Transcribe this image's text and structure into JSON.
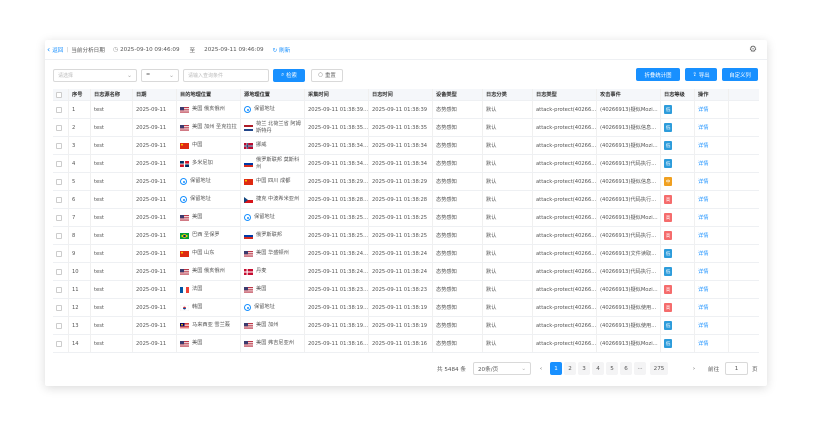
{
  "topbar": {
    "back_label": "返回",
    "divider": "|",
    "analysis_label": "当前分析日期",
    "start": "2025-09-10 09:46:09",
    "to": "至",
    "end": "2025-09-11 09:46:09",
    "refresh": "刷新"
  },
  "filters": {
    "type_placeholder": "请选择",
    "op_value": "=",
    "query_placeholder": "请输入查询条件",
    "search_label": "检索",
    "reset_label": "重置"
  },
  "actions": {
    "stats_label": "折叠统计图",
    "export_label": "导出",
    "custom_columns_label": "自定义列"
  },
  "columns": [
    "序号",
    "日志源名称",
    "日期",
    "目的地理位置",
    "源地理位置",
    "采集时间",
    "日志时间",
    "设备类型",
    "日志分类",
    "日志类型",
    "攻击事件",
    "日志等级",
    "操作"
  ],
  "rows": [
    {
      "no": "1",
      "src": "test",
      "date": "2025-09-11",
      "dest": "美国 俄亥俄州",
      "dest_flag": "us",
      "srcloc": "保留地址",
      "srcloc_flag": "pin",
      "collect": "2025-09-11 01:38:39...",
      "log": "2025-09-11 01:38:39",
      "device": "态势感知",
      "cls": "默认",
      "type": "attack-protect(40266...",
      "event": "(40266913)疑似Mozi...",
      "lvl": "低",
      "op": "详情"
    },
    {
      "no": "2",
      "src": "test",
      "date": "2025-09-11",
      "dest": "美国 加州 圣克拉拉",
      "dest_flag": "us",
      "srcloc": "荷兰 北荷兰省 阿姆斯特丹",
      "srcloc_flag": "nl",
      "collect": "2025-09-11 01:38:35...",
      "log": "2025-09-11 01:38:35",
      "device": "态势感知",
      "cls": "默认",
      "type": "attack-protect(40266...",
      "event": "(40266913)疑似信息...",
      "lvl": "低",
      "op": "详情"
    },
    {
      "no": "3",
      "src": "test",
      "date": "2025-09-11",
      "dest": "中国",
      "dest_flag": "cn",
      "srcloc": "挪威",
      "srcloc_flag": "no",
      "collect": "2025-09-11 01:38:34...",
      "log": "2025-09-11 01:38:34",
      "device": "态势感知",
      "cls": "默认",
      "type": "attack-protect(40266...",
      "event": "(40266913)疑似Mozi...",
      "lvl": "低",
      "op": "详情"
    },
    {
      "no": "4",
      "src": "test",
      "date": "2025-09-11",
      "dest": "多米尼加",
      "dest_flag": "do",
      "srcloc": "俄罗斯联邦 莫斯科州",
      "srcloc_flag": "ru",
      "collect": "2025-09-11 01:38:34...",
      "log": "2025-09-11 01:38:34",
      "device": "态势感知",
      "cls": "默认",
      "type": "attack-protect(40266...",
      "event": "(40266913)代码执行...",
      "lvl": "低",
      "op": "详情"
    },
    {
      "no": "5",
      "src": "test",
      "date": "2025-09-11",
      "dest": "保留地址",
      "dest_flag": "pin",
      "srcloc": "中国 四川 成都",
      "srcloc_flag": "cn",
      "collect": "2025-09-11 01:38:29...",
      "log": "2025-09-11 01:38:29",
      "device": "态势感知",
      "cls": "默认",
      "type": "attack-protect(40266...",
      "event": "(40266913)疑似信息...",
      "lvl": "中",
      "op": "详情"
    },
    {
      "no": "6",
      "src": "test",
      "date": "2025-09-11",
      "dest": "保留地址",
      "dest_flag": "pin",
      "srcloc": "捷克 中波希米亚州",
      "srcloc_flag": "cz",
      "collect": "2025-09-11 01:38:28...",
      "log": "2025-09-11 01:38:28",
      "device": "态势感知",
      "cls": "默认",
      "type": "attack-protect(40266...",
      "event": "(40266913)代码执行...",
      "lvl": "高",
      "op": "详情"
    },
    {
      "no": "7",
      "src": "test",
      "date": "2025-09-11",
      "dest": "美国",
      "dest_flag": "us",
      "srcloc": "保留地址",
      "srcloc_flag": "pin",
      "collect": "2025-09-11 01:38:25...",
      "log": "2025-09-11 01:38:25",
      "device": "态势感知",
      "cls": "默认",
      "type": "attack-protect(40266...",
      "event": "(40266913)疑似Mozi...",
      "lvl": "高",
      "op": "详情"
    },
    {
      "no": "8",
      "src": "test",
      "date": "2025-09-11",
      "dest": "巴西 圣保罗",
      "dest_flag": "br",
      "srcloc": "俄罗斯联邦",
      "srcloc_flag": "ru",
      "collect": "2025-09-11 01:38:25...",
      "log": "2025-09-11 01:38:25",
      "device": "态势感知",
      "cls": "默认",
      "type": "attack-protect(40266...",
      "event": "(40266913)代码执行...",
      "lvl": "高",
      "op": "详情"
    },
    {
      "no": "9",
      "src": "test",
      "date": "2025-09-11",
      "dest": "中国 山东",
      "dest_flag": "cn",
      "srcloc": "美国 华盛顿州",
      "srcloc_flag": "us",
      "collect": "2025-09-11 01:38:24...",
      "log": "2025-09-11 01:38:24",
      "device": "态势感知",
      "cls": "默认",
      "type": "attack-protect(40266...",
      "event": "(40266913)文件读取...",
      "lvl": "低",
      "op": "详情"
    },
    {
      "no": "10",
      "src": "test",
      "date": "2025-09-11",
      "dest": "美国 俄亥俄州",
      "dest_flag": "us",
      "srcloc": "丹麦",
      "srcloc_flag": "dk",
      "collect": "2025-09-11 01:38:24...",
      "log": "2025-09-11 01:38:24",
      "device": "态势感知",
      "cls": "默认",
      "type": "attack-protect(40266...",
      "event": "(40266913)代码执行...",
      "lvl": "低",
      "op": "详情"
    },
    {
      "no": "11",
      "src": "test",
      "date": "2025-09-11",
      "dest": "法国",
      "dest_flag": "fr",
      "srcloc": "美国",
      "srcloc_flag": "us",
      "collect": "2025-09-11 01:38:23...",
      "log": "2025-09-11 01:38:23",
      "device": "态势感知",
      "cls": "默认",
      "type": "attack-protect(40266...",
      "event": "(40266913)疑似Mozi...",
      "lvl": "高",
      "op": "详情"
    },
    {
      "no": "12",
      "src": "test",
      "date": "2025-09-11",
      "dest": "韩国",
      "dest_flag": "kr",
      "srcloc": "保留地址",
      "srcloc_flag": "pin",
      "collect": "2025-09-11 01:38:19...",
      "log": "2025-09-11 01:38:19",
      "device": "态势感知",
      "cls": "默认",
      "type": "attack-protect(40266...",
      "event": "(40266913)疑似使用...",
      "lvl": "高",
      "op": "详情"
    },
    {
      "no": "13",
      "src": "test",
      "date": "2025-09-11",
      "dest": "马来西亚 雪兰莪",
      "dest_flag": "my",
      "srcloc": "美国 加州",
      "srcloc_flag": "us",
      "collect": "2025-09-11 01:38:19...",
      "log": "2025-09-11 01:38:19",
      "device": "态势感知",
      "cls": "默认",
      "type": "attack-protect(40266...",
      "event": "(40266913)疑似使用...",
      "lvl": "低",
      "op": "详情"
    },
    {
      "no": "14",
      "src": "test",
      "date": "2025-09-11",
      "dest": "美国",
      "dest_flag": "us",
      "srcloc": "美国 弗吉尼亚州",
      "srcloc_flag": "us",
      "collect": "2025-09-11 01:38:16...",
      "log": "2025-09-11 01:38:16",
      "device": "态势感知",
      "cls": "默认",
      "type": "attack-protect(40266...",
      "event": "(40266913)疑似Mozi...",
      "lvl": "低",
      "op": "详情"
    }
  ],
  "level_colors": {
    "低": "#2d9cdb",
    "中": "#f0a020",
    "高": "#f56c6c"
  },
  "pagination": {
    "total": "共 5484 条",
    "page_size": "20条/页",
    "pages": [
      "1",
      "2",
      "3",
      "4",
      "5",
      "6",
      "···",
      "275"
    ],
    "prev": "‹",
    "next": "›",
    "goto": "前往",
    "goto_value": "1",
    "unit": "页"
  }
}
